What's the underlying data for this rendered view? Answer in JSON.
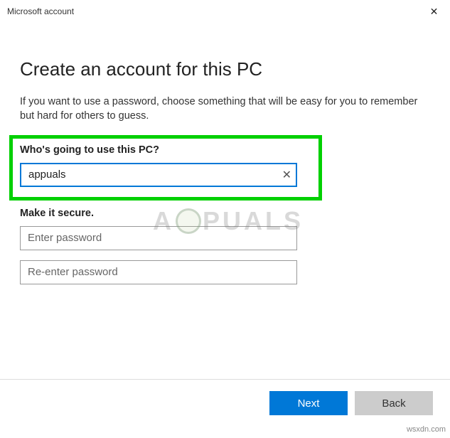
{
  "window": {
    "title": "Microsoft account"
  },
  "heading": "Create an account for this PC",
  "intro": "If you want to use a password, choose something that will be easy for you to remember but hard for others to guess.",
  "user_section": {
    "label": "Who's going to use this PC?",
    "value": "appuals"
  },
  "secure_section": {
    "label": "Make it secure.",
    "password_placeholder": "Enter password",
    "reenter_placeholder": "Re-enter password"
  },
  "buttons": {
    "next": "Next",
    "back": "Back"
  },
  "watermark": {
    "left": "A",
    "right": "PUALS"
  },
  "source": "wsxdn.com"
}
